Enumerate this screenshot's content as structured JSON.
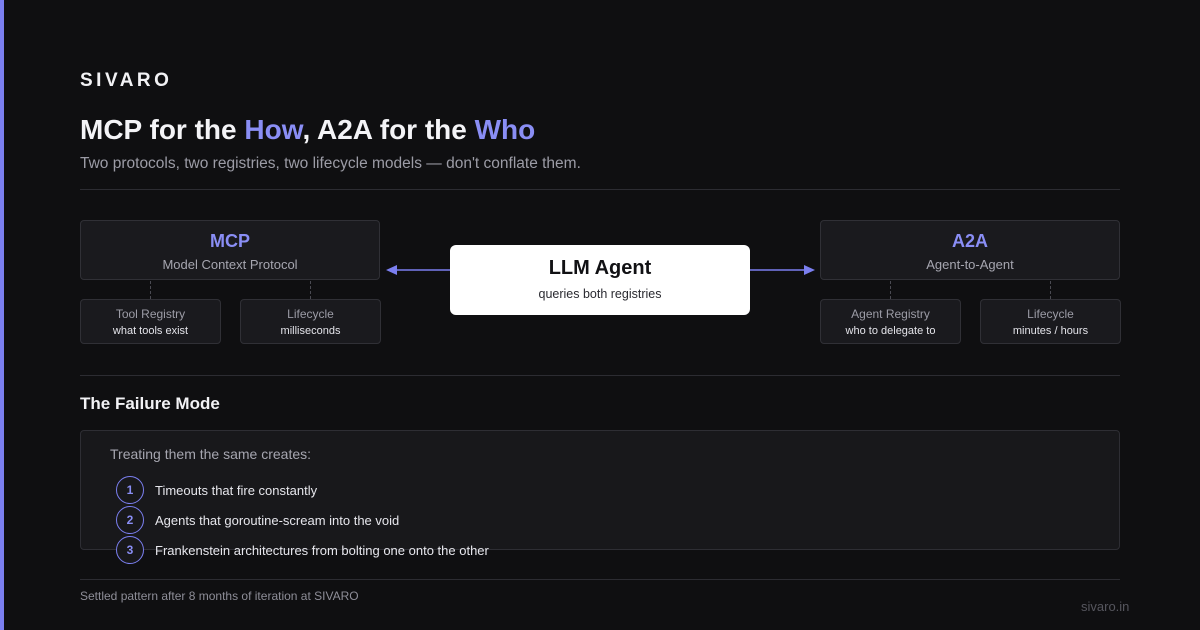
{
  "brand": "SIVARO",
  "title": {
    "part1": "MCP for the ",
    "hl1": "How",
    "part2": ", A2A for the ",
    "hl2": "Who"
  },
  "subtitle": "Two protocols, two registries, two lifecycle models — don't conflate them.",
  "colors": {
    "background": "#0f0f11",
    "accent": "#7b7ff0",
    "accent_text": "#8a8ef5",
    "panel": "#1a1a1e",
    "agent_box": "#ffffff"
  },
  "diagram": {
    "mcp": {
      "name": "MCP",
      "description": "Model Context Protocol",
      "children": [
        {
          "label": "Tool Registry",
          "value": "what tools exist"
        },
        {
          "label": "Lifecycle",
          "value": "milliseconds"
        }
      ]
    },
    "agent": {
      "name": "LLM Agent",
      "description": "queries both registries"
    },
    "a2a": {
      "name": "A2A",
      "description": "Agent-to-Agent",
      "children": [
        {
          "label": "Agent Registry",
          "value": "who to delegate to"
        },
        {
          "label": "Lifecycle",
          "value": "minutes / hours"
        }
      ]
    }
  },
  "failure": {
    "title": "The Failure Mode",
    "intro": "Treating them the same creates:",
    "items": [
      {
        "num": "1",
        "text": "Timeouts that fire constantly"
      },
      {
        "num": "2",
        "text": "Agents that goroutine-scream into the void"
      },
      {
        "num": "3",
        "text": "Frankenstein architectures from bolting one onto the other"
      }
    ]
  },
  "footer": {
    "note": "Settled pattern after 8 months of iteration at SIVARO",
    "url": "sivaro.in"
  }
}
